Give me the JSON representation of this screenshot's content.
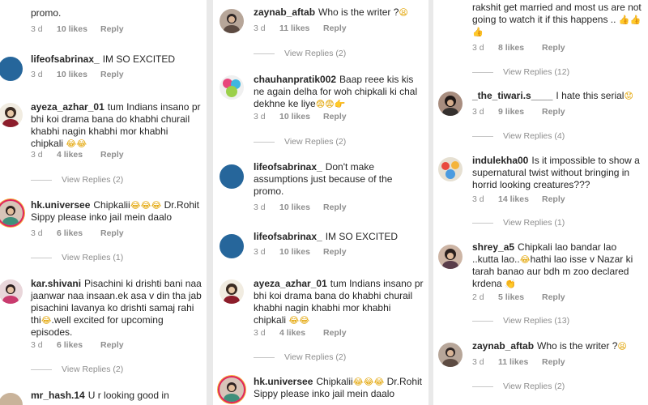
{
  "col1": {
    "c0": {
      "text": "promo.",
      "date": "3 d",
      "likes": "10 likes",
      "reply": "Reply"
    },
    "c1": {
      "username": "lifeofsabrinax_",
      "text": "IM SO EXCITED",
      "date": "3 d",
      "likes": "10 likes",
      "reply": "Reply"
    },
    "c2": {
      "username": "ayeza_azhar_01",
      "text": "tum Indians insano pr bhi koi drama bana do khabhi churail khabhi nagin khabhi mor khabhi chipkali",
      "emoji": "😂😂",
      "date": "3 d",
      "likes": "4 likes",
      "reply": "Reply",
      "view_replies": "View Replies (2)"
    },
    "c3": {
      "username": "hk.universee",
      "text": "Chipkalii",
      "emoji": "😂😂😂",
      "text2": "Dr.Rohit Sippy please inko jail mein daalo",
      "date": "3 d",
      "likes": "6 likes",
      "reply": "Reply",
      "view_replies": "View Replies (1)"
    },
    "c4": {
      "username": "kar.shivani",
      "text": "Pisachini ki drishti bani naa jaanwar naa insaan.ek asa v din tha jab pisachini lavanya ko drishti samaj rahi thi",
      "emoji": "😂",
      "text2": ".well excited for upcoming episodes.",
      "date": "3 d",
      "likes": "6 likes",
      "reply": "Reply",
      "view_replies": "View Replies (2)"
    },
    "c5": {
      "username": "mr_hash.14",
      "text": "U r looking good in"
    }
  },
  "col2": {
    "c0": {
      "username": "zaynab_aftab",
      "text": "Who is the writer ?",
      "emoji": "😫",
      "date": "3 d",
      "likes": "11 likes",
      "reply": "Reply",
      "view_replies": "View Replies (2)"
    },
    "c1": {
      "username": "chauhanpratik002",
      "text": "Baap reee kis kis ne again delha for woh chipkali ki chal dekhne ke liye",
      "emoji": "😨😨👉",
      "date": "3 d",
      "likes": "10 likes",
      "reply": "Reply",
      "view_replies": "View Replies (2)"
    },
    "c2": {
      "username": "lifeofsabrinax_",
      "text": "Don't make assumptions just because of the promo.",
      "date": "3 d",
      "likes": "10 likes",
      "reply": "Reply"
    },
    "c3": {
      "username": "lifeofsabrinax_",
      "text": "IM SO EXCITED",
      "date": "3 d",
      "likes": "10 likes",
      "reply": "Reply"
    },
    "c4": {
      "username": "ayeza_azhar_01",
      "text": "tum Indians insano pr bhi koi drama bana do khabhi churail khabhi nagin khabhi mor khabhi chipkali",
      "emoji": "😂😂",
      "date": "3 d",
      "likes": "4 likes",
      "reply": "Reply",
      "view_replies": "View Replies (2)"
    },
    "c5": {
      "username": "hk.universee",
      "text": "Chipkalii",
      "emoji": "😂😂😂",
      "text2": "Dr.Rohit Sippy please inko jail mein daalo"
    }
  },
  "col3": {
    "c0": {
      "text": "rakshit get married and most us are not going to watch it if this happens ..",
      "emoji": "👍👍👍",
      "date": "3 d",
      "likes": "8 likes",
      "reply": "Reply",
      "view_replies": "View Replies (12)"
    },
    "c1": {
      "username": "_the_tiwari.s____",
      "text": "I hate this serial",
      "emoji": "😟",
      "date": "3 d",
      "likes": "9 likes",
      "reply": "Reply",
      "view_replies": "View Replies (4)"
    },
    "c2": {
      "username": "indulekha00",
      "text": "Is it impossible to show a supernatural twist without bringing in horrid looking creatures???",
      "date": "3 d",
      "likes": "14 likes",
      "reply": "Reply",
      "view_replies": "View Replies (1)"
    },
    "c3": {
      "username": "shrey_a5",
      "text": "Chipkali lao bandar lao ..kutta lao..",
      "emoji": "😂",
      "text2": "hathi lao isse v Nazar ki tarah banao aur bdh m zoo declared krdena",
      "emoji2": "👏",
      "date": "2 d",
      "likes": "5 likes",
      "reply": "Reply",
      "view_replies": "View Replies (13)"
    },
    "c4": {
      "username": "zaynab_aftab",
      "text": "Who is the writer ?",
      "emoji": "😫",
      "date": "3 d",
      "likes": "11 likes",
      "reply": "Reply",
      "view_replies": "View Replies (2)"
    }
  }
}
